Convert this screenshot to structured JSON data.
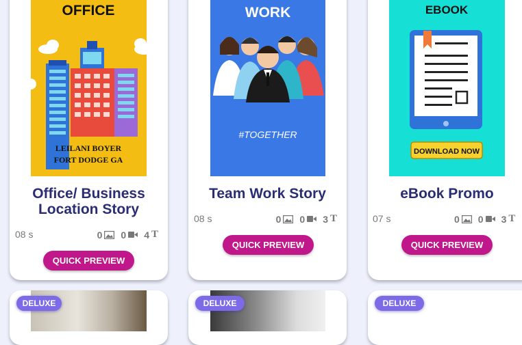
{
  "cards": [
    {
      "title": "Office/ Business Location Story",
      "duration": "08 s",
      "images": "0",
      "videos": "0",
      "texts": "4",
      "button": "QUICK PREVIEW",
      "thumb": {
        "heading": "OFFICE",
        "line1": "LEILANI BOYER",
        "line2": "FORT DODGE GA",
        "bg": "#f4bd13"
      }
    },
    {
      "title": "Team Work Story",
      "duration": "08 s",
      "images": "0",
      "videos": "0",
      "texts": "3",
      "button": "QUICK PREVIEW",
      "thumb": {
        "heading": "WORK",
        "tagline": "#TOGETHER",
        "bg": "#3a78e6"
      }
    },
    {
      "title": "eBook Promo",
      "duration": "07 s",
      "images": "0",
      "videos": "0",
      "texts": "3",
      "button": "QUICK PREVIEW",
      "thumb": {
        "heading": "EBOOK",
        "cta": "DOWNLOAD NOW",
        "bg": "#16e0d6"
      }
    }
  ],
  "bottom_cards": [
    {
      "badge": "DELUXE"
    },
    {
      "badge": "DELUXE"
    },
    {
      "badge": "DELUXE"
    }
  ],
  "colors": {
    "accent": "#c0178a",
    "title": "#2b2d72",
    "badge": "#7c6ae6"
  },
  "icons": {
    "image": "image-icon",
    "video": "video-camera-icon",
    "text": "text-icon"
  }
}
